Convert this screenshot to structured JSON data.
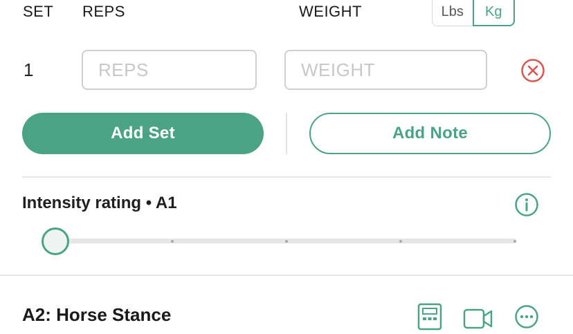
{
  "headers": {
    "set": "SET",
    "reps": "REPS",
    "weight": "WEIGHT"
  },
  "unit_toggle": {
    "lbs": "Lbs",
    "kg": "Kg",
    "selected": "Kg"
  },
  "set_row": {
    "number": "1",
    "reps_placeholder": "REPS",
    "weight_placeholder": "WEIGHT"
  },
  "buttons": {
    "add_set": "Add Set",
    "add_note": "Add Note"
  },
  "intensity": {
    "label": "Intensity rating • A1",
    "slider_level": 0,
    "slider_steps": 5
  },
  "next_exercise": {
    "title": "A2: Horse Stance"
  },
  "icons": {
    "remove_set": "close-circle-icon",
    "info": "info-icon",
    "calculator": "calculator-icon",
    "video": "video-camera-icon",
    "more": "more-options-icon"
  },
  "colors": {
    "accent": "#4aa384",
    "danger": "#d9534f"
  }
}
